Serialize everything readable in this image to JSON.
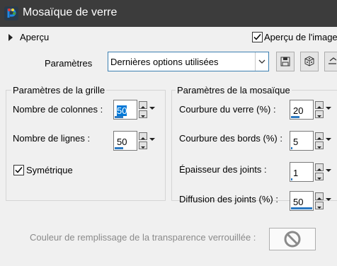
{
  "window": {
    "title": "Mosaïque de verre"
  },
  "apercu": {
    "label": "Aperçu",
    "preview_checkbox_label": "Aperçu de l'image",
    "preview_checked": true
  },
  "parametres": {
    "label": "Paramètres",
    "dropdown_value": "Dernières options utilisées"
  },
  "grille": {
    "title": "Paramètres de la grille",
    "colonnes": {
      "label": "Nombre de colonnes :",
      "value": "50"
    },
    "lignes": {
      "label": "Nombre de lignes :",
      "value": "50"
    },
    "symetrique": {
      "label": "Symétrique",
      "checked": true
    }
  },
  "mosaique": {
    "title": "Paramètres de la mosaïque",
    "courbure_verre": {
      "label": "Courbure du verre (%) :",
      "value": "20"
    },
    "courbure_bords": {
      "label": "Courbure des bords (%) :",
      "value": "5"
    },
    "epaisseur": {
      "label": "Épaisseur des joints :",
      "value": "1"
    },
    "diffusion": {
      "label": "Diffusion des joints (%) :",
      "value": "50"
    }
  },
  "transparence": {
    "label": "Couleur de remplissage de la transparence verrouillée :"
  },
  "icons": [
    "paintshop-icon",
    "expand-triangle-icon",
    "save-preset-icon",
    "random-dice-icon",
    "reset-icon",
    "spin-up-icon",
    "spin-down-icon",
    "dropdown-arrow-icon",
    "no-color-icon"
  ],
  "colors": {
    "titlebar": "#3c3c3c",
    "accent": "#0078d7",
    "bar": "#2b79c2"
  }
}
